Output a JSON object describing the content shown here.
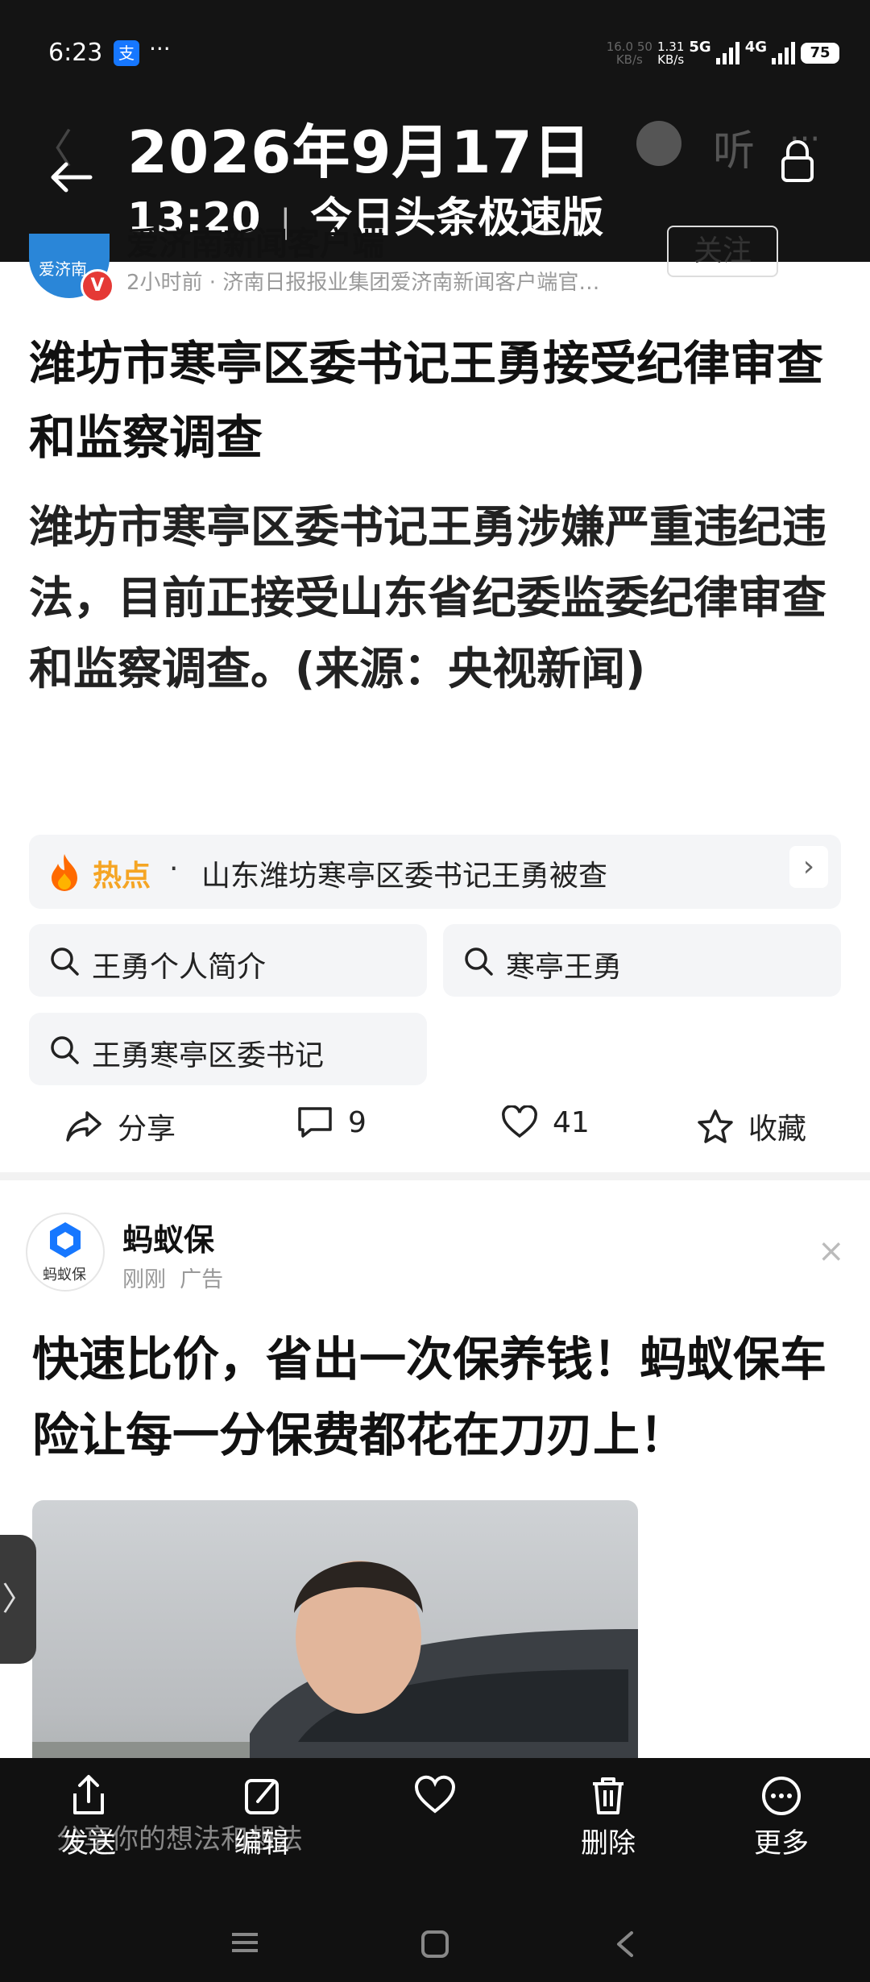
{
  "status": {
    "time": "6:23",
    "alipay": "支",
    "dots": "···",
    "net_speed": "1.31",
    "net_unit": "KB/s",
    "net_speed_ghost": "16.0 50",
    "net_unit_ghost": "KB/s",
    "sig1": "5G",
    "sig2": "4G",
    "battery": "75"
  },
  "overlay": {
    "date": "2026年9月17日",
    "time": "13:20",
    "separator": "|",
    "app": "今日头条极速版"
  },
  "ghost_header": {
    "listen": "听",
    "more": "···",
    "follow": "关注"
  },
  "source": {
    "name": "爱济南新闻客户端",
    "logo_text": "爱济南",
    "verified": "V",
    "meta": "2小时前 · 济南日报报业集团爱济南新闻客户端官…"
  },
  "article": {
    "title": "潍坊市寒亭区委书记王勇接受纪律审查和监察调查",
    "body": "潍坊市寒亭区委书记王勇涉嫌严重违纪违法，目前正接受山东省纪委监委纪律审查和监察调查。(来源：央视新闻)"
  },
  "hot": {
    "label": "热点",
    "dot": "·",
    "text": "山东潍坊寒亭区委书记王勇被查",
    "chevron": "›"
  },
  "chips": [
    "王勇个人简介",
    "寒亭王勇",
    "王勇寒亭区委书记"
  ],
  "actions": {
    "share": "分享",
    "comments": "9",
    "likes": "41",
    "collect": "收藏"
  },
  "ad": {
    "name": "蚂蚁保",
    "logo_text": "蚂蚁保",
    "time": "刚刚",
    "tag": "广告",
    "close": "×",
    "text": "快速比价，省出一次保养钱！蚂蚁保车险让每一分保费都花在刀刃上！"
  },
  "ghost_share_text": "分享你的想法和想法",
  "bottom_bar": {
    "send": "发送",
    "edit": "编辑",
    "like": "",
    "delete": "删除",
    "more": "更多"
  },
  "side_tab": "〉"
}
